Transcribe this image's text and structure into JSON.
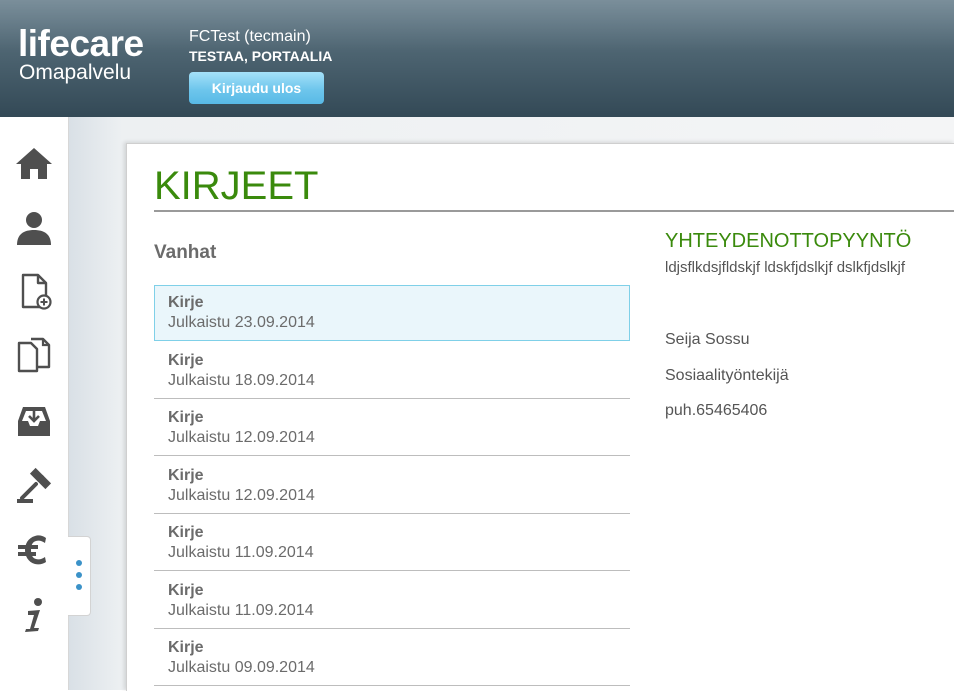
{
  "header": {
    "logo_main": "lifecare",
    "logo_sub": "Omapalvelu",
    "user_name": "FCTest (tecmain)",
    "user_org": "TESTAA, PORTAALIA",
    "logout_label": "Kirjaudu ulos"
  },
  "sidebar": {
    "items": [
      {
        "icon": "home-icon"
      },
      {
        "icon": "user-icon"
      },
      {
        "icon": "new-document-icon"
      },
      {
        "icon": "documents-icon"
      },
      {
        "icon": "inbox-icon"
      },
      {
        "icon": "gavel-icon"
      },
      {
        "icon": "euro-icon"
      },
      {
        "icon": "info-icon"
      }
    ],
    "icon_color": "#4f4f4f"
  },
  "page": {
    "title": "KIRJEET",
    "section_heading": "Vanhat"
  },
  "letters": [
    {
      "title": "Kirje",
      "date": "Julkaistu 23.09.2014",
      "selected": true
    },
    {
      "title": "Kirje",
      "date": "Julkaistu 18.09.2014",
      "selected": false
    },
    {
      "title": "Kirje",
      "date": "Julkaistu 12.09.2014",
      "selected": false
    },
    {
      "title": "Kirje",
      "date": "Julkaistu 12.09.2014",
      "selected": false
    },
    {
      "title": "Kirje",
      "date": "Julkaistu 11.09.2014",
      "selected": false
    },
    {
      "title": "Kirje",
      "date": "Julkaistu 11.09.2014",
      "selected": false
    },
    {
      "title": "Kirje",
      "date": "Julkaistu 09.09.2014",
      "selected": false
    }
  ],
  "detail": {
    "title": "YHTEYDENOTTOPYYNTÖ",
    "body": "ldjsflkdsjfldskjf ldskfjdslkjf dslkfjdslkjf",
    "sender_name": "Seija Sossu",
    "sender_role": "Sosiaalityöntekijä",
    "sender_phone": "puh.65465406"
  },
  "colors": {
    "accent_green": "#3a8a0c",
    "header_dark": "#334956",
    "button_blue": "#6ec6ec",
    "selection_border": "#7fd0e8"
  }
}
